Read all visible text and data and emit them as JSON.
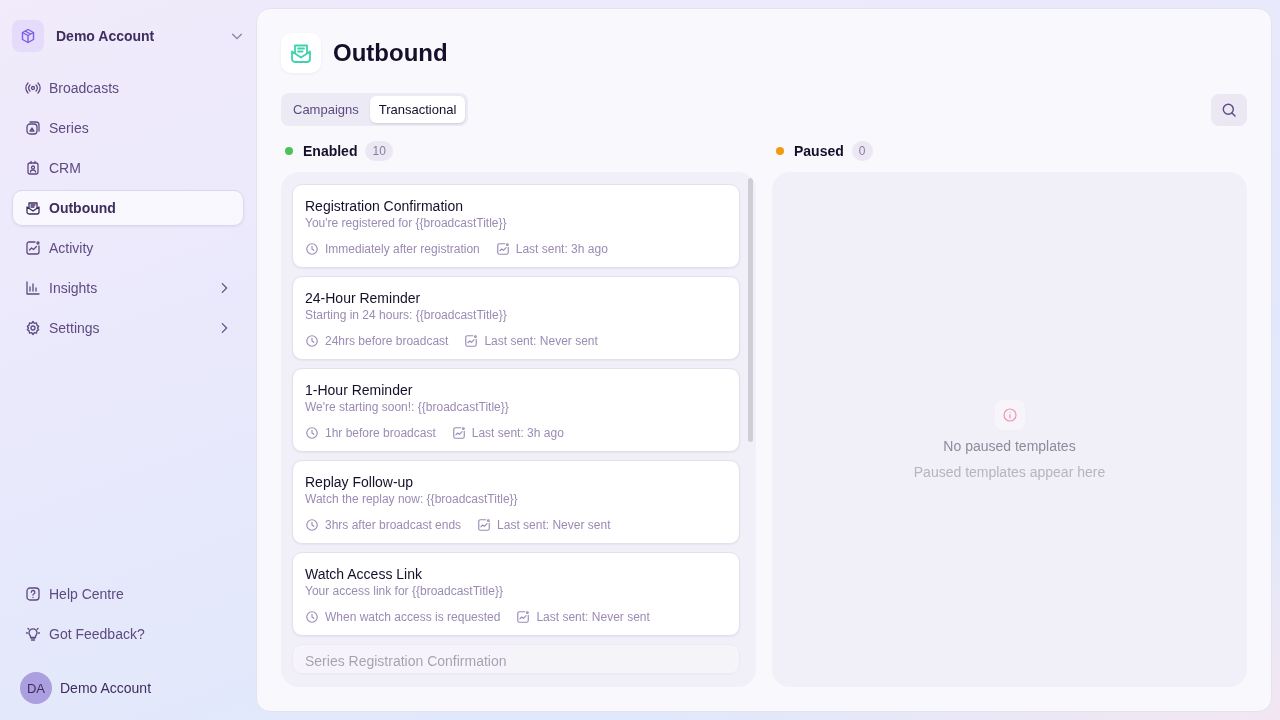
{
  "account": {
    "name": "Demo Account"
  },
  "nav": [
    {
      "label": "Broadcasts",
      "selected": false,
      "expandable": false
    },
    {
      "label": "Series",
      "selected": false,
      "expandable": false
    },
    {
      "label": "CRM",
      "selected": false,
      "expandable": false
    },
    {
      "label": "Outbound",
      "selected": true,
      "expandable": false
    },
    {
      "label": "Activity",
      "selected": false,
      "expandable": false
    },
    {
      "label": "Insights",
      "selected": false,
      "expandable": true
    },
    {
      "label": "Settings",
      "selected": false,
      "expandable": true
    }
  ],
  "footer_links": [
    "Help Centre",
    "Got Feedback?"
  ],
  "user": {
    "initials": "DA",
    "name": "Demo Account"
  },
  "page": {
    "title": "Outbound"
  },
  "tabs": [
    {
      "label": "Campaigns",
      "selected": false
    },
    {
      "label": "Transactional",
      "selected": true
    }
  ],
  "columns": [
    {
      "label": "Enabled",
      "color": "#4cc35a",
      "count": "10",
      "templates": [
        {
          "title": "Registration Confirmation",
          "subject": "You're registered for {{broadcastTitle}}",
          "trigger": "Immediately after registration",
          "last_sent": "Last sent: 3h ago"
        },
        {
          "title": "24-Hour Reminder",
          "subject": "Starting in 24 hours: {{broadcastTitle}}",
          "trigger": "24hrs before broadcast",
          "last_sent": "Last sent: Never sent"
        },
        {
          "title": "1-Hour Reminder",
          "subject": "We're starting soon!: {{broadcastTitle}}",
          "trigger": "1hr before broadcast",
          "last_sent": "Last sent: 3h ago"
        },
        {
          "title": "Replay Follow-up",
          "subject": "Watch the replay now: {{broadcastTitle}}",
          "trigger": "3hrs after broadcast ends",
          "last_sent": "Last sent: Never sent"
        },
        {
          "title": "Watch Access Link",
          "subject": "Your access link for {{broadcastTitle}}",
          "trigger": "When watch access is requested",
          "last_sent": "Last sent: Never sent"
        },
        {
          "title": "Series Registration Confirmation"
        }
      ]
    },
    {
      "label": "Paused",
      "color": "#f29a0e",
      "count": "0",
      "empty": {
        "title": "No paused templates",
        "subtitle": "Paused templates appear here"
      }
    }
  ]
}
